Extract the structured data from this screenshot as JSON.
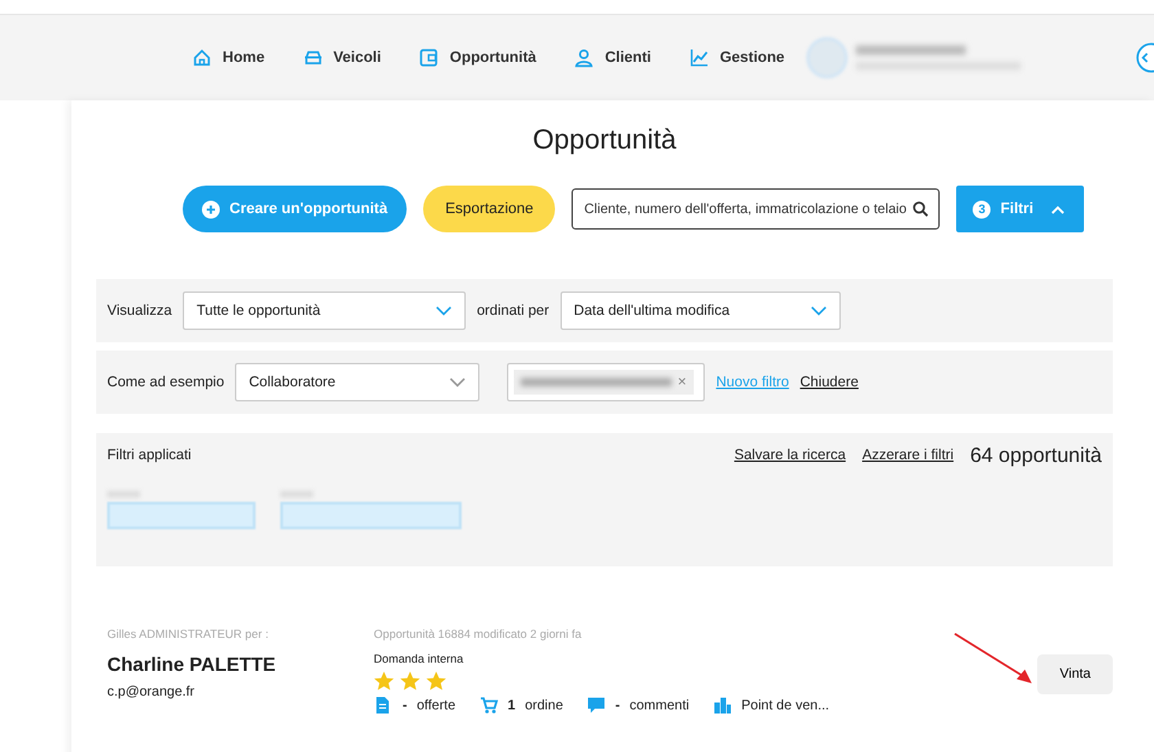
{
  "nav": [
    {
      "label": "Home"
    },
    {
      "label": "Veicoli"
    },
    {
      "label": "Opportunità"
    },
    {
      "label": "Clienti"
    },
    {
      "label": "Gestione"
    }
  ],
  "title": "Opportunità",
  "actions": {
    "create": "Creare un'opportunità",
    "export": "Esportazione",
    "search_placeholder": "Cliente, numero dell'offerta, immatricolazione o telaio",
    "filter_count": "3",
    "filter_label": "Filtri"
  },
  "view_row": {
    "label": "Visualizza",
    "view_value": "Tutte le opportunità",
    "sort_label": "ordinati per",
    "sort_value": "Data dell'ultima modifica"
  },
  "filter_row": {
    "label": "Come ad esempio",
    "field_value": "Collaboratore",
    "remove": "×",
    "new_filter": "Nuovo filtro",
    "close": "Chiudere"
  },
  "applied": {
    "label": "Filtri applicati",
    "save": "Salvare la ricerca",
    "reset": "Azzerare i filtri",
    "count": "64 opportunità"
  },
  "opportunity": {
    "owner": "Gilles ADMINISTRATEUR per :",
    "name": "Charline PALETTE",
    "email": "c.p@orange.fr",
    "meta": "Opportunità 16884 modificato 2 giorni fa",
    "type": "Domanda interna",
    "stars": 3,
    "stats": [
      {
        "value": "-",
        "label": "offerte"
      },
      {
        "value": "1",
        "label": "ordine"
      },
      {
        "value": "-",
        "label": "commenti"
      },
      {
        "label": "Point de ven..."
      }
    ],
    "status": "Vinta"
  }
}
